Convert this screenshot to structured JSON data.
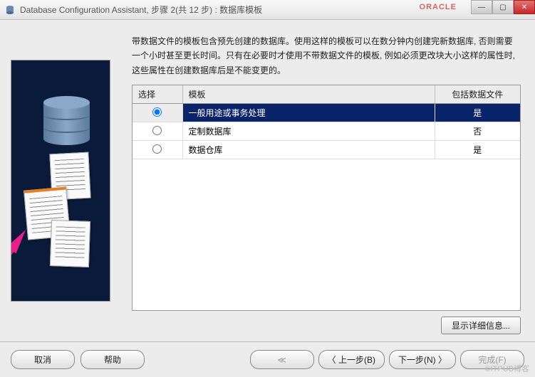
{
  "window": {
    "title": "Database Configuration Assistant, 步骤 2(共 12 步) : 数据库模板",
    "brand": "ORACLE"
  },
  "description": "带数据文件的模板包含预先创建的数据库。使用这样的模板可以在数分钟内创建完新数据库, 否则需要一个小时甚至更长时间。只有在必要时才使用不带数据文件的模板, 例如必须更改块大小这样的属性时, 这些属性在创建数据库后是不能变更的。",
  "table": {
    "headers": {
      "select": "选择",
      "template": "模板",
      "include": "包括数据文件"
    },
    "rows": [
      {
        "selected": true,
        "template": "一般用途或事务处理",
        "include": "是"
      },
      {
        "selected": false,
        "template": "定制数据库",
        "include": "否"
      },
      {
        "selected": false,
        "template": "数据仓库",
        "include": "是"
      }
    ]
  },
  "buttons": {
    "details": "显示详细信息...",
    "cancel": "取消",
    "help": "帮助",
    "back": "上一步(B)",
    "next": "下一步(N)",
    "finish": "完成(F)"
  },
  "nav_glyphs": {
    "first": "≪",
    "back": "〈",
    "next": "〉"
  },
  "watermark": "©ITPUB博客"
}
